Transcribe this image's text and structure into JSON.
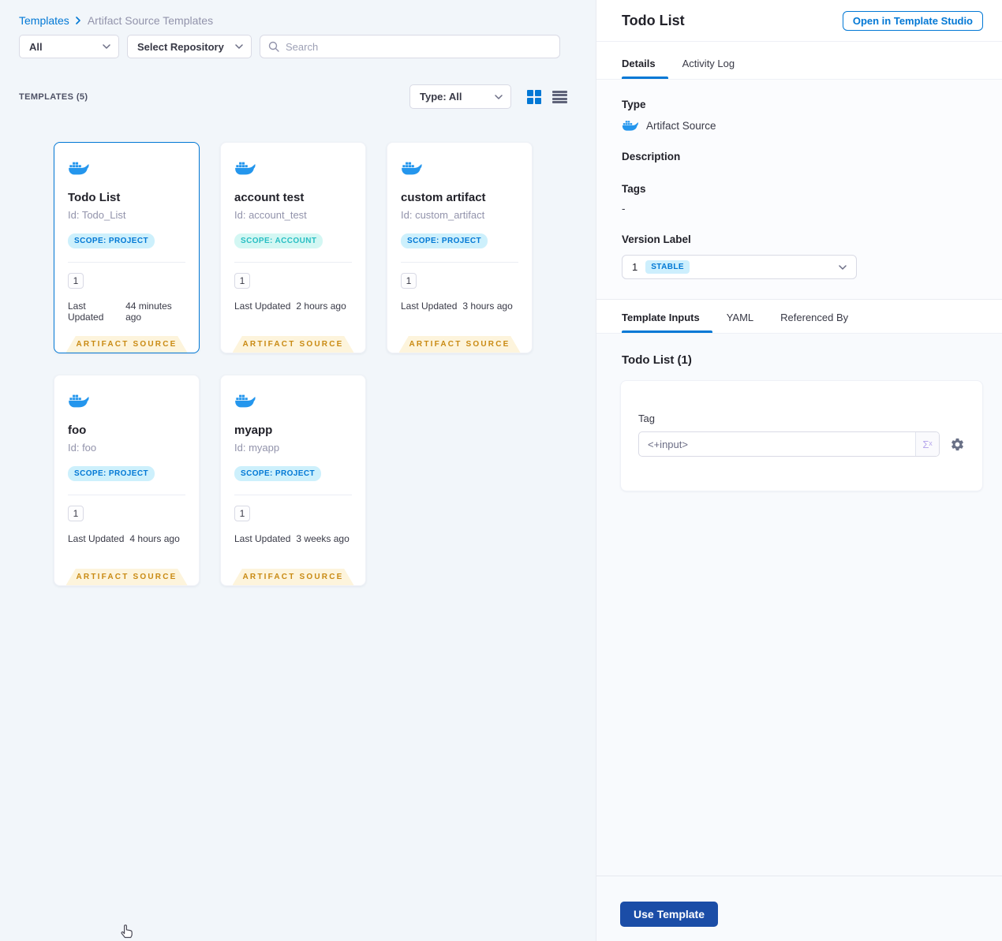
{
  "breadcrumb": {
    "templates_link": "Templates",
    "current": "Artifact Source Templates"
  },
  "filters": {
    "scope": "All",
    "repository": "Select Repository",
    "search_placeholder": "Search"
  },
  "list_header": {
    "count": "TEMPLATES (5)",
    "type_filter": "Type: All"
  },
  "card_labels": {
    "updated": "Last Updated",
    "ribbon": "ARTIFACT SOURCE"
  },
  "cards": [
    {
      "title": "Todo List",
      "id": "Id: Todo_List",
      "scope": "SCOPE: PROJECT",
      "version_count": "1",
      "updated": "44 minutes ago"
    },
    {
      "title": "account test",
      "id": "Id: account_test",
      "scope": "SCOPE: ACCOUNT",
      "version_count": "1",
      "updated": "2 hours ago"
    },
    {
      "title": "custom artifact",
      "id": "Id: custom_artifact",
      "scope": "SCOPE: PROJECT",
      "version_count": "1",
      "updated": "3 hours ago"
    },
    {
      "title": "foo",
      "id": "Id: foo",
      "scope": "SCOPE: PROJECT",
      "version_count": "1",
      "updated": "4 hours ago"
    },
    {
      "title": "myapp",
      "id": "Id: myapp",
      "scope": "SCOPE: PROJECT",
      "version_count": "1",
      "updated": "3 weeks ago"
    }
  ],
  "panel": {
    "title": "Todo List",
    "open_in_studio": "Open in Template Studio",
    "tabs": {
      "details": "Details",
      "activity_log": "Activity Log"
    },
    "details": {
      "type_label": "Type",
      "type_value": "Artifact Source",
      "description_label": "Description",
      "tags_label": "Tags",
      "tags_value": "-",
      "version_label": "Version Label",
      "version_value": "1",
      "version_badge": "STABLE"
    },
    "sub_tabs": {
      "template_inputs": "Template Inputs",
      "yaml": "YAML",
      "referenced_by": "Referenced By"
    },
    "inputs": {
      "heading": "Todo List (1)",
      "tag_label": "Tag",
      "tag_value": "<+input>",
      "expression_glyph": "Σˣ"
    },
    "footer": {
      "use_template": "Use Template"
    }
  },
  "colors": {
    "accent": "#0278D5",
    "docker_blue": "#2496ED",
    "primary_button": "#1B4DA7",
    "ribbon_bg": "#FDF4DC",
    "ribbon_text": "#C98A13",
    "scope_project_text": "#0278D5",
    "scope_account_text": "#28BEC3",
    "stable_badge_bg": "#CDEFFD"
  }
}
